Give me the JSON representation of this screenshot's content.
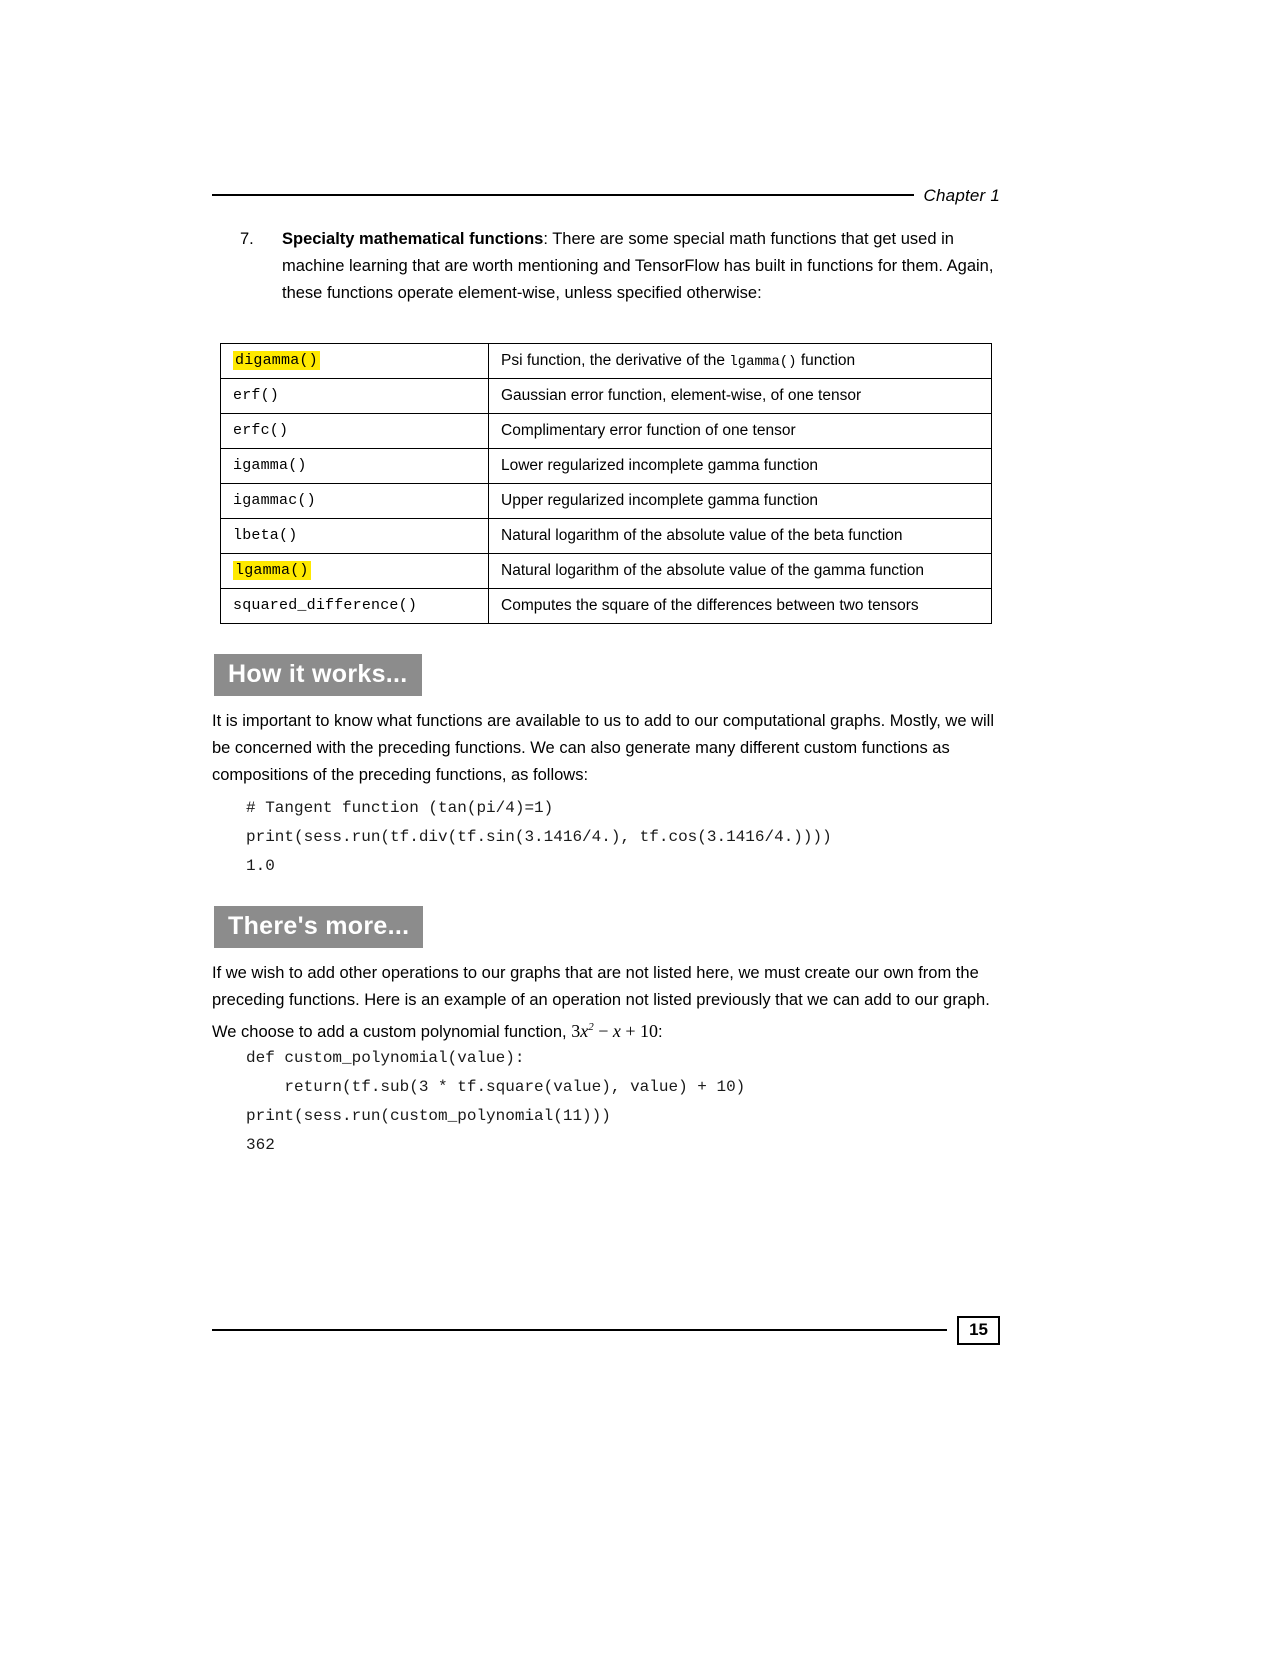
{
  "header": {
    "chapter_label": "Chapter 1"
  },
  "list_item": {
    "marker": "7.",
    "title": "Specialty mathematical functions",
    "text": ": There are some special math functions that get used in machine learning that are worth mentioning and TensorFlow has built in functions for them. Again, these functions operate element-wise, unless specified otherwise:"
  },
  "table": {
    "rows": [
      {
        "function": "digamma()",
        "highlight": true,
        "description_before": "Psi function, the derivative of the ",
        "description_code": "lgamma()",
        "description_after": " function"
      },
      {
        "function": "erf()",
        "highlight": false,
        "description_before": "Gaussian error function, element-wise, of one tensor",
        "description_code": "",
        "description_after": ""
      },
      {
        "function": "erfc()",
        "highlight": false,
        "description_before": "Complimentary error function of one tensor",
        "description_code": "",
        "description_after": ""
      },
      {
        "function": "igamma()",
        "highlight": false,
        "description_before": "Lower regularized incomplete gamma function",
        "description_code": "",
        "description_after": ""
      },
      {
        "function": "igammac()",
        "highlight": false,
        "description_before": "Upper regularized incomplete gamma function",
        "description_code": "",
        "description_after": ""
      },
      {
        "function": "lbeta()",
        "highlight": false,
        "description_before": "Natural logarithm of the absolute value of the beta function",
        "description_code": "",
        "description_after": ""
      },
      {
        "function": "lgamma()",
        "highlight": true,
        "description_before": "Natural logarithm of the absolute value of the gamma function",
        "description_code": "",
        "description_after": ""
      },
      {
        "function": "squared_difference()",
        "highlight": false,
        "description_before": "Computes the square of the differences between two tensors",
        "description_code": "",
        "description_after": ""
      }
    ]
  },
  "sections": {
    "how_it_works": {
      "heading": "How it works...",
      "paragraph": "It is important to know what functions are available to us to add to our computational graphs. Mostly, we will be concerned with the preceding functions. We can also generate many different custom functions as compositions of the preceding functions, as follows:",
      "code": "# Tangent function (tan(pi/4)=1)\nprint(sess.run(tf.div(tf.sin(3.1416/4.), tf.cos(3.1416/4.))))",
      "code_output": "1.0"
    },
    "theres_more": {
      "heading": "There's more...",
      "paragraph_part1": "If we wish to add other operations to our graphs that are not listed here, we must create our own from the preceding functions. Here is an example of an operation not listed previously that we can add to our graph. We choose to add a custom polynomial function, ",
      "math_coefficient": "3",
      "math_variable": "x",
      "math_exponent": "2",
      "math_minus": " − ",
      "math_variable2": "x",
      "math_plus": " + ",
      "math_constant": "10",
      "paragraph_part2": ":",
      "code": "def custom_polynomial(value):\n    return(tf.sub(3 * tf.square(value), value) + 10)\nprint(sess.run(custom_polynomial(11)))\n362"
    }
  },
  "footer": {
    "page_number": "15"
  },
  "colors": {
    "banner_background": "#8c8c8c",
    "banner_text": "#ffffff",
    "highlight": "#ffe900",
    "rule": "#000000"
  }
}
